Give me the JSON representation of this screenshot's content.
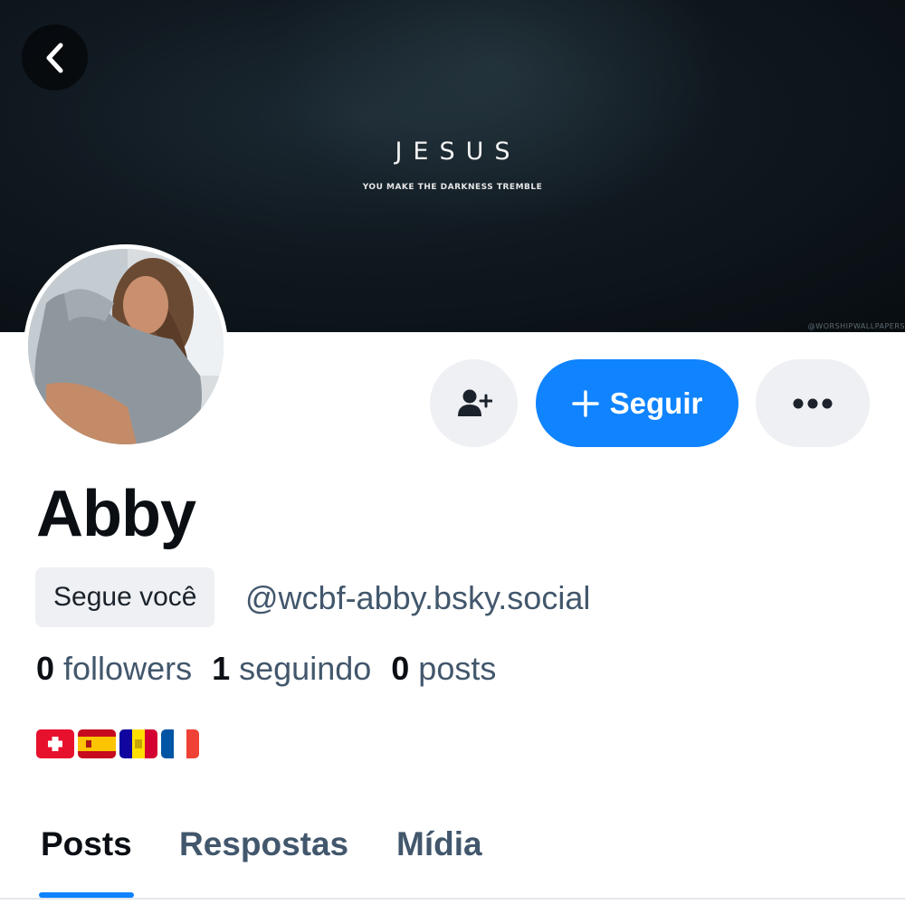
{
  "banner": {
    "title": "JESUS",
    "subtitle": "YOU MAKE THE DARKNESS TREMBLE",
    "watermark": "@WORSHIPWALLPAPERS"
  },
  "header": {
    "back_icon": "chevron-left-icon"
  },
  "profile": {
    "display_name": "Abby",
    "follows_you_label": "Segue você",
    "handle": "@wcbf-abby.bsky.social",
    "stats": {
      "followers_count": "0",
      "followers_label": "followers",
      "following_count": "1",
      "following_label": "seguindo",
      "posts_count": "0",
      "posts_label": "posts"
    },
    "bio_flags": [
      "Switzerland",
      "Spain",
      "Andorra",
      "France"
    ]
  },
  "actions": {
    "add_user_icon": "person-plus-icon",
    "follow_label": "Seguir",
    "follow_icon": "plus-icon",
    "more_icon": "ellipsis-icon"
  },
  "tabs": [
    {
      "label": "Posts",
      "active": true
    },
    {
      "label": "Respostas",
      "active": false
    },
    {
      "label": "Mídia",
      "active": false
    }
  ],
  "colors": {
    "accent": "#1083fe",
    "muted_text": "#42576c",
    "button_bg": "#eef0f3"
  }
}
